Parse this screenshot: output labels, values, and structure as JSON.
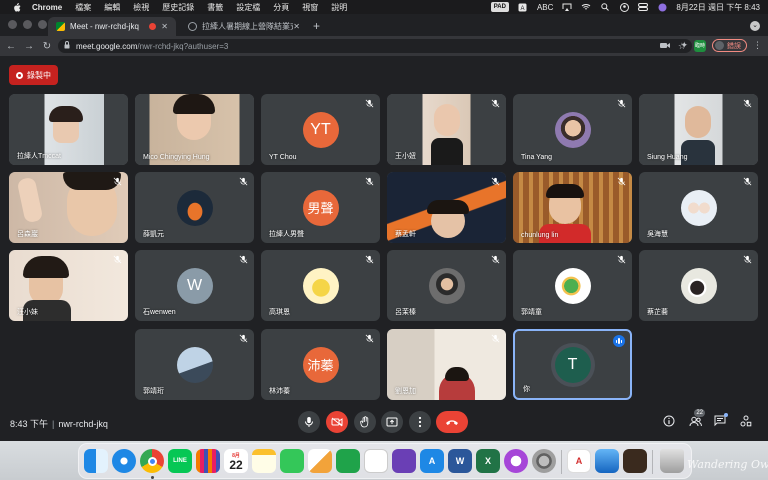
{
  "menubar": {
    "app": "Chrome",
    "items": [
      "檔案",
      "編輯",
      "檢視",
      "歷史記錄",
      "書籤",
      "設定檔",
      "分頁",
      "視窗",
      "說明"
    ],
    "input_badge": "PAD",
    "input_source": "ABC",
    "datetime": "8月22日 週日 下午 8:43"
  },
  "browser": {
    "tabs": [
      {
        "title": "Meet - nwr-rchd-jkq",
        "active": true
      },
      {
        "title": "拉縴人暑期線上營隊結業式.pdf",
        "active": false
      }
    ],
    "url_host": "meet.google.com",
    "url_path": "/nwr-rchd-jkq?authuser=3",
    "ext_label": "臨時",
    "error_label": "錯誤"
  },
  "meet": {
    "recording_label": "錄製中",
    "meeting_time": "8:43 下午",
    "meeting_code": "nwr-rchd-jkq",
    "people_count": "22",
    "tiles": [
      {
        "name": "拉縴人Tmccat",
        "initial": "",
        "color": "#cfd8dc"
      },
      {
        "name": "Mico Chingying Hung",
        "initial": "",
        "color": "#c9b8a3"
      },
      {
        "name": "YT Chou",
        "initial": "YT",
        "color": "#e8683a"
      },
      {
        "name": "王小妞",
        "initial": "",
        "color": "#e6d3c4"
      },
      {
        "name": "Tina Yang",
        "initial": "",
        "color": "#5a4a6e"
      },
      {
        "name": "Siung Huang",
        "initial": "",
        "color": "#dadde0"
      },
      {
        "name": "呂森巖",
        "initial": "",
        "color": "#c8b3a0"
      },
      {
        "name": "薛凱元",
        "initial": "",
        "color": "#1c2a3a"
      },
      {
        "name": "拉縴人男聲",
        "initial": "男聲",
        "color": "#e8683a"
      },
      {
        "name": "蔡孟軒",
        "initial": "",
        "color": "#233044"
      },
      {
        "name": "chunlung lin",
        "initial": "",
        "color": "#b57a3c"
      },
      {
        "name": "吳海慧",
        "initial": "",
        "color": "#e9eff5"
      },
      {
        "name": "汪小妹",
        "initial": "",
        "color": "#d5b9a5"
      },
      {
        "name": "石wenwen",
        "initial": "W",
        "color": "#8a9ba8"
      },
      {
        "name": "高琪恩",
        "initial": "",
        "color": "#fff3c4"
      },
      {
        "name": "呂茉榛",
        "initial": "",
        "color": "#4a4a4a"
      },
      {
        "name": "郭靖童",
        "initial": "",
        "color": "#ffffff"
      },
      {
        "name": "蔡芷蕎",
        "initial": "",
        "color": "#e8e8e0"
      },
      {
        "name": "郭靖珩",
        "initial": "",
        "color": "#bfd3e6"
      },
      {
        "name": "林沛蓁",
        "initial": "沛蓁",
        "color": "#e8683a"
      },
      {
        "name": "劉恩加",
        "initial": "",
        "color": "#d8d2c8"
      },
      {
        "name": "你",
        "initial": "T",
        "color": "#1e5e4e"
      }
    ]
  },
  "dock": {
    "calendar_month": "8月",
    "calendar_day": "22",
    "watermark": "Wandering Owl"
  },
  "colors": {
    "meet_bg": "#202124",
    "tile_bg": "#3c4043",
    "record_red": "#c5221f",
    "hangup_red": "#ea4335",
    "self_border": "#8ab4f8"
  }
}
